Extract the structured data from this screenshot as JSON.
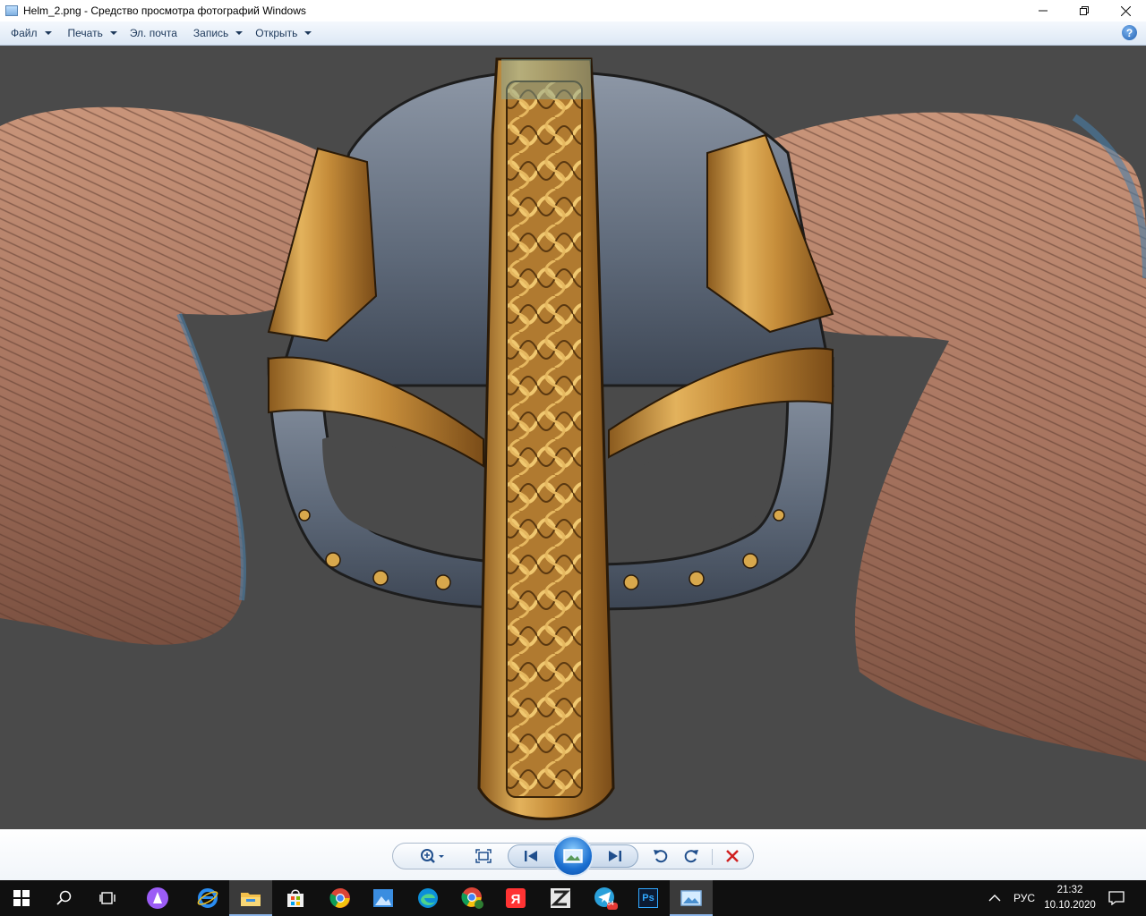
{
  "window": {
    "title": "Helm_2.png - Средство просмотра фотографий Windows",
    "minimize_icon": "minimize-icon",
    "maximize_icon": "restore-icon",
    "close_icon": "close-icon"
  },
  "menubar": {
    "items": [
      {
        "label": "Файл",
        "has_dropdown": true
      },
      {
        "label": "Печать",
        "has_dropdown": true
      },
      {
        "label": "Эл. почта",
        "has_dropdown": false
      },
      {
        "label": "Запись",
        "has_dropdown": true
      },
      {
        "label": "Открыть",
        "has_dropdown": true
      }
    ],
    "help_label": "?"
  },
  "viewer": {
    "background": "#4a4a4a",
    "image": "viking-helmet-with-horns"
  },
  "controls": {
    "buttons": [
      "zoom-icon",
      "fit-to-window-icon",
      "previous-icon",
      "slideshow-icon",
      "next-icon",
      "rotate-left-icon",
      "rotate-right-icon",
      "delete-icon"
    ]
  },
  "taskbar": {
    "apps": [
      "start-icon",
      "search-icon",
      "task-view-icon",
      "alice-icon",
      "internet-explorer-icon",
      "file-explorer-icon",
      "store-icon",
      "chrome-icon",
      "photos-icon",
      "edge-icon",
      "chrome-profile-icon",
      "yandex-icon",
      "zbrush-icon",
      "telegram-icon",
      "photoshop-icon",
      "photo-viewer-icon"
    ],
    "telegram_badge": "64",
    "photoshop_label": "Ps",
    "language": "РУС",
    "time": "21:32",
    "date": "10.10.2020"
  }
}
